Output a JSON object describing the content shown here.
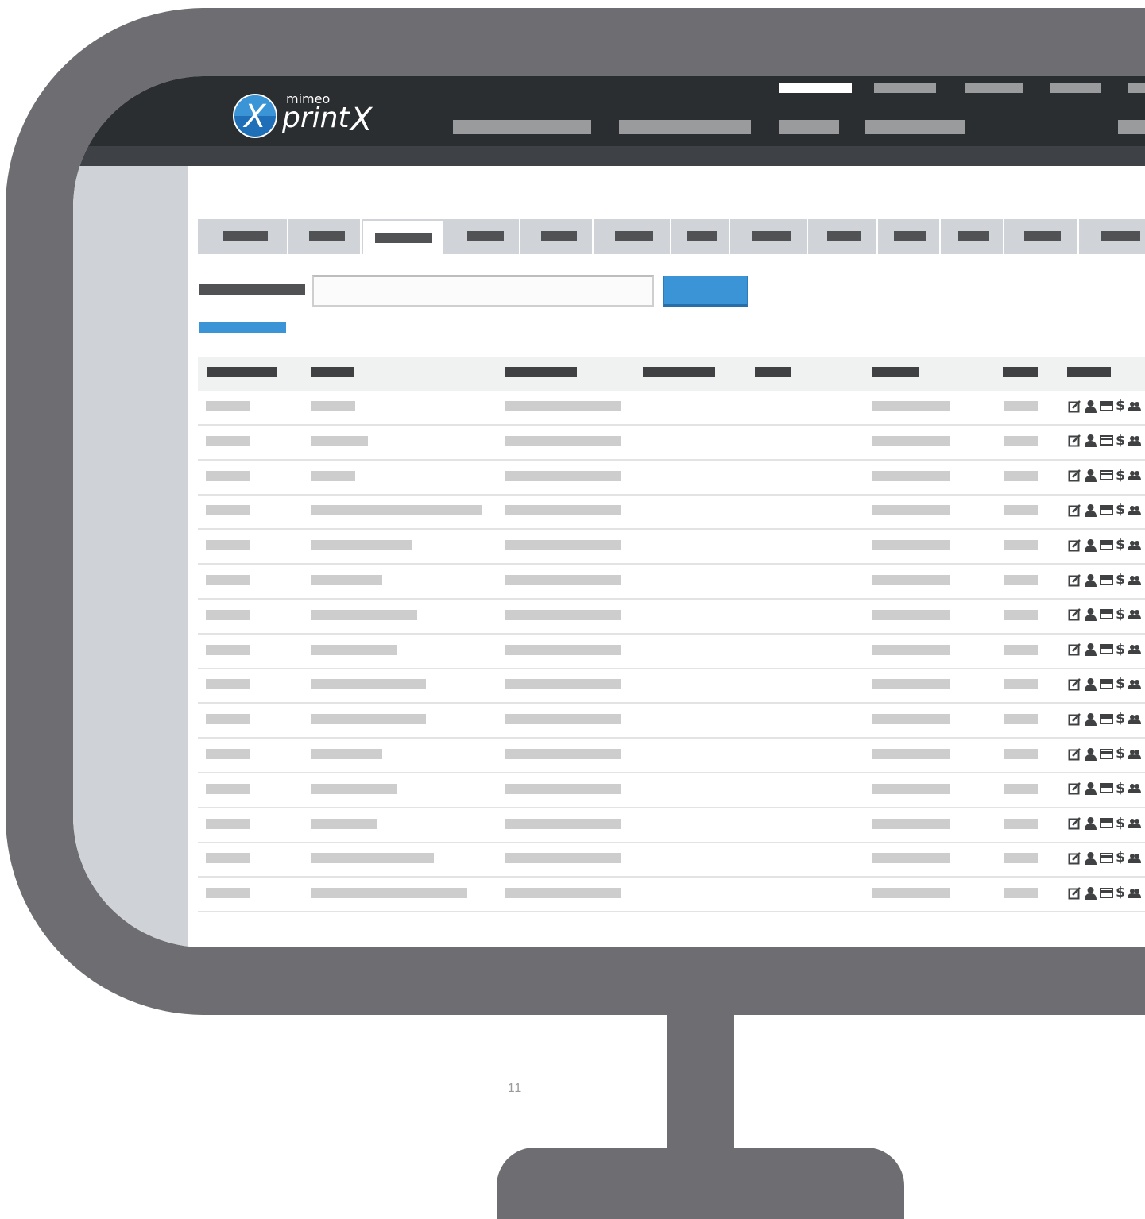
{
  "page_number": "11",
  "logo": {
    "brand": "mimeo",
    "product": "print",
    "mark": "X",
    "accent_color": "#1e6fb8"
  },
  "colors": {
    "accent": "#3a94d6",
    "nav_bg": "#2b2e31",
    "frame": "#6e6e72"
  },
  "table": {
    "row_count": 15,
    "action_icons": [
      "edit-icon",
      "user-icon",
      "card-icon",
      "dollar-icon",
      "group-icon"
    ],
    "dollar_glyph": "$"
  }
}
